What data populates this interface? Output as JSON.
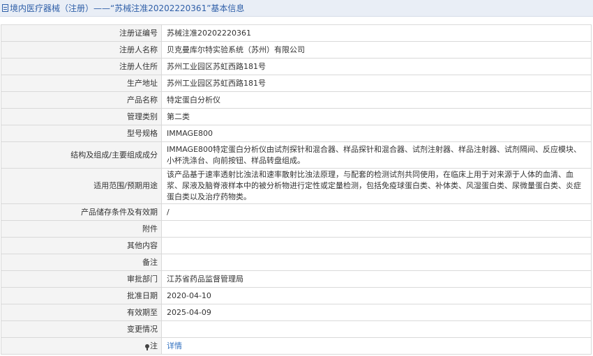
{
  "page": {
    "title": "境内医疗器械（注册）——“苏械注准20202220361”基本信息",
    "icon": "document-icon"
  },
  "colors": {
    "title_bar_bg": "#e9eef6",
    "title_text": "#2f5fa8",
    "label_bg": "#f4f4f4",
    "border": "#d9d9d9",
    "link": "#2f6fbf"
  },
  "rows": [
    {
      "label": "注册证编号",
      "value": "苏械注准20202220361"
    },
    {
      "label": "注册人名称",
      "value": "贝克曼库尔特实验系统（苏州）有限公司"
    },
    {
      "label": "注册人住所",
      "value": "苏州工业园区苏虹西路181号"
    },
    {
      "label": "生产地址",
      "value": "苏州工业园区苏虹西路181号"
    },
    {
      "label": "产品名称",
      "value": "特定蛋白分析仪"
    },
    {
      "label": "管理类别",
      "value": "第二类"
    },
    {
      "label": "型号规格",
      "value": "IMMAGE800"
    },
    {
      "label": "结构及组成/主要组成成分",
      "value": "IMMAGE800特定蛋白分析仪由试剂探针和混合器、样品探针和混合器、试剂注射器、样品注射器、试剂隔间、反应模块、小杯洗涤台、向前按钮、样品转盘组成。"
    },
    {
      "label": "适用范围/预期用途",
      "value": "该产品基于速率透射比浊法和速率散射比浊法原理，与配套的检测试剂共同使用，在临床上用于对来源于人体的血清、血浆、尿液及脑脊液样本中的被分析物进行定性或定量检测，包括免疫球蛋白类、补体类、风湿蛋白类、尿微量蛋白类、炎症蛋白类以及治疗药物类。"
    },
    {
      "label": "产品储存条件及有效期",
      "value": "/"
    },
    {
      "label": "附件",
      "value": ""
    },
    {
      "label": "其他内容",
      "value": ""
    },
    {
      "label": "备注",
      "value": ""
    },
    {
      "label": "审批部门",
      "value": "江苏省药品监督管理局"
    },
    {
      "label": "批准日期",
      "value": "2020-04-10"
    },
    {
      "label": "有效期至",
      "value": "2025-04-09"
    },
    {
      "label": "变更情况",
      "value": ""
    }
  ],
  "note_row": {
    "label": "注",
    "icon": "pin-icon",
    "link": "详情"
  }
}
